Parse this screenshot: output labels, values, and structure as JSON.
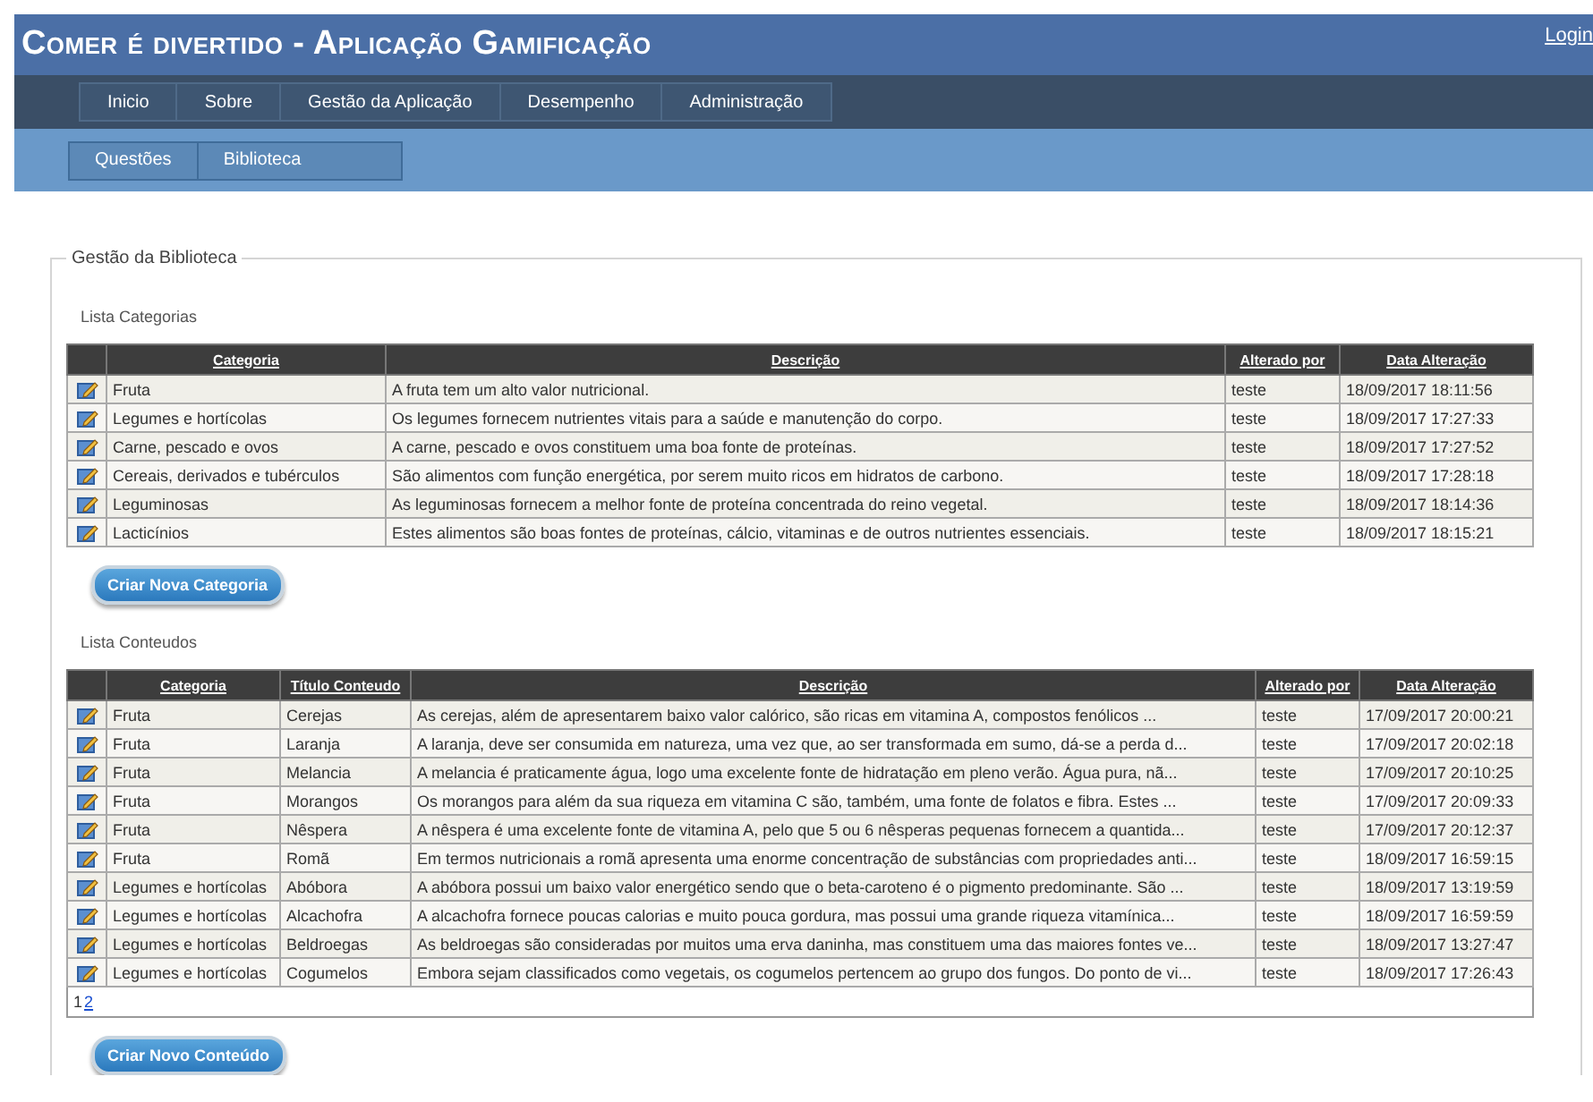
{
  "header": {
    "title": "Comer é divertido - Aplicação Gamificação",
    "login": "Login"
  },
  "nav": [
    "Inicio",
    "Sobre",
    "Gestão da Aplicação",
    "Desempenho",
    "Administração"
  ],
  "subnav": [
    "Questões",
    "Biblioteca"
  ],
  "section": {
    "title": "Gestão da Biblioteca"
  },
  "categories": {
    "title": "Lista Categorias",
    "columns": [
      "Categoria",
      "Descrição",
      "Alterado por",
      "Data Alteração"
    ],
    "rows": [
      [
        "Fruta",
        "A fruta tem um alto valor nutricional.",
        "teste",
        "18/09/2017 18:11:56"
      ],
      [
        "Legumes e hortícolas",
        "Os legumes fornecem nutrientes vitais para a saúde e manutenção do corpo.",
        "teste",
        "18/09/2017 17:27:33"
      ],
      [
        "Carne, pescado e ovos",
        "A carne, pescado e ovos constituem uma boa fonte de proteínas.",
        "teste",
        "18/09/2017 17:27:52"
      ],
      [
        "Cereais, derivados e tubérculos",
        "São alimentos com função energética, por serem muito ricos em hidratos de carbono.",
        "teste",
        "18/09/2017 17:28:18"
      ],
      [
        "Leguminosas",
        "As leguminosas fornecem a melhor fonte de proteína concentrada do reino vegetal.",
        "teste",
        "18/09/2017 18:14:36"
      ],
      [
        "Lacticínios",
        "Estes alimentos são boas fontes de proteínas, cálcio, vitaminas e de outros nutrientes essenciais.",
        "teste",
        "18/09/2017 18:15:21"
      ]
    ],
    "button": "Criar Nova Categoria"
  },
  "contents": {
    "title": "Lista Conteudos",
    "columns": [
      "Categoria",
      "Título Conteudo",
      "Descrição",
      "Alterado por",
      "Data Alteração"
    ],
    "rows": [
      [
        "Fruta",
        "Cerejas",
        "As cerejas, além de apresentarem baixo valor calórico, são ricas em vitamina A, compostos fenólicos ...",
        "teste",
        "17/09/2017 20:00:21"
      ],
      [
        "Fruta",
        "Laranja",
        "A laranja, deve ser consumida em natureza, uma vez que, ao ser transformada em sumo, dá-se a perda d...",
        "teste",
        "17/09/2017 20:02:18"
      ],
      [
        "Fruta",
        "Melancia",
        "A melancia é praticamente água, logo uma excelente fonte de hidratação em pleno verão. Água pura, nã...",
        "teste",
        "17/09/2017 20:10:25"
      ],
      [
        "Fruta",
        "Morangos",
        "Os morangos para além da sua riqueza em vitamina C são, também, uma fonte de folatos e fibra. Estes ...",
        "teste",
        "17/09/2017 20:09:33"
      ],
      [
        "Fruta",
        "Nêspera",
        "A nêspera é uma excelente fonte de vitamina A, pelo que 5 ou 6 nêsperas pequenas fornecem a quantida...",
        "teste",
        "17/09/2017 20:12:37"
      ],
      [
        "Fruta",
        "Romã",
        "Em termos nutricionais a romã apresenta uma enorme concentração de substâncias com propriedades anti...",
        "teste",
        "18/09/2017 16:59:15"
      ],
      [
        "Legumes e hortícolas",
        "Abóbora",
        "A abóbora possui um baixo valor energético sendo que o beta-caroteno é o pigmento predominante. São ...",
        "teste",
        "18/09/2017 13:19:59"
      ],
      [
        "Legumes e hortícolas",
        "Alcachofra",
        "A alcachofra fornece poucas calorias e muito pouca gordura, mas possui uma grande riqueza vitamínica...",
        "teste",
        "18/09/2017 16:59:59"
      ],
      [
        "Legumes e hortícolas",
        "Beldroegas",
        "As beldroegas são consideradas por muitos uma erva daninha, mas constituem uma das maiores fontes ve...",
        "teste",
        "18/09/2017 13:27:47"
      ],
      [
        "Legumes e hortícolas",
        "Cogumelos",
        "Embora sejam classificados como vegetais, os cogumelos pertencem ao grupo dos fungos. Do ponto de vi...",
        "teste",
        "18/09/2017 17:26:43"
      ]
    ],
    "pages": [
      {
        "label": "1",
        "selected": true
      },
      {
        "label": "2",
        "selected": false
      }
    ],
    "button": "Criar Novo Conteúdo"
  }
}
